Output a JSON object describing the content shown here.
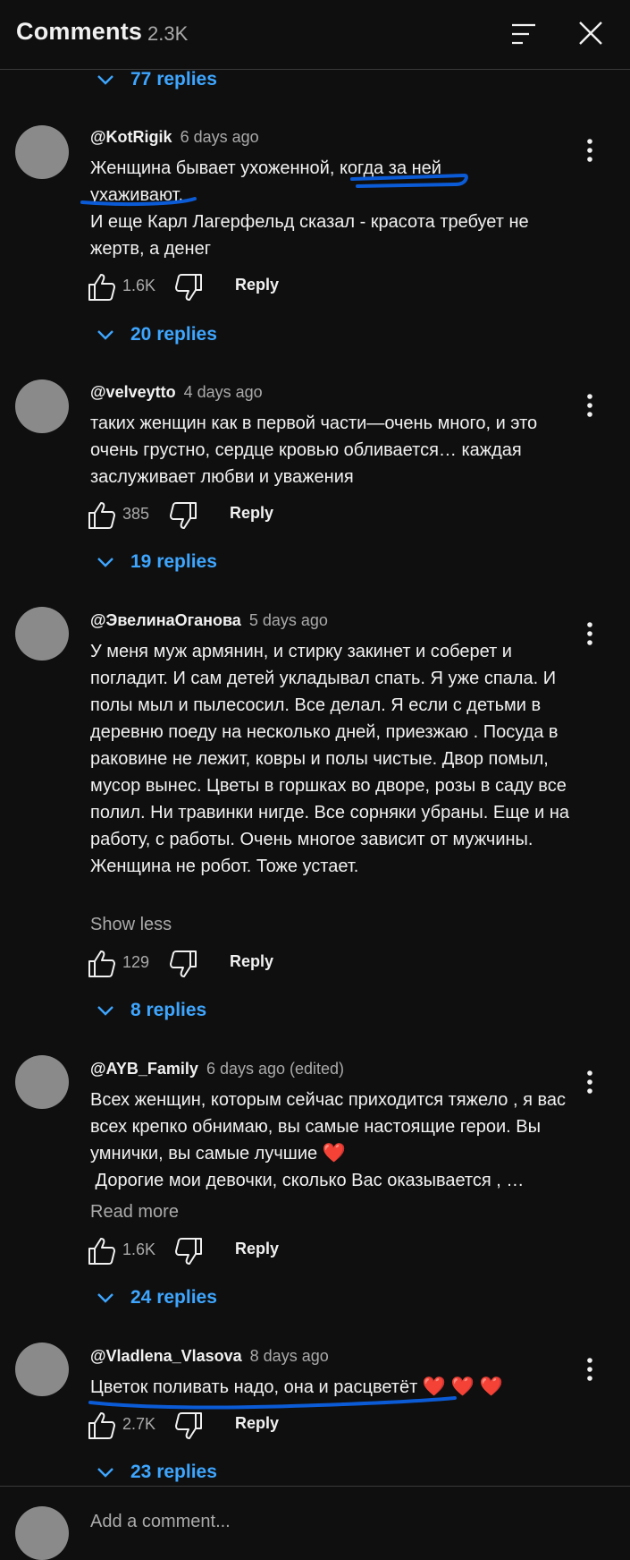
{
  "header": {
    "title": "Comments",
    "count": "2.3K"
  },
  "icons": {
    "sort": "sort-icon",
    "close": "close-icon",
    "like": "thumbs-up-icon",
    "dislike": "thumbs-down-icon",
    "more": "more-vertical-icon",
    "expand": "chevron-down-icon"
  },
  "colors": {
    "background": "#0f0f0f",
    "link": "#3ea6ff",
    "muted": "#aaaaaa",
    "avatar": "#8a8a8a",
    "heart": "#e2262c",
    "marker": "#0b5bd6"
  },
  "top_replies": "77 replies",
  "comments": [
    {
      "handle": "@KotRigik",
      "time": "6 days ago",
      "lines": [
        "Женщина бывает ухоженной, когда за ней ухаживают.",
        "И еще Карл Лагерфельд сказал - красота требует не жертв, а денег"
      ],
      "likes": "1.6K",
      "reply": "Reply",
      "replies": "20 replies"
    },
    {
      "handle": "@velveytto",
      "time": "4 days ago",
      "lines": [
        "таких женщин как в первой части—очень много, и это очень грустно, сердце кровью обливается… каждая заслуживает любви и уважения"
      ],
      "likes": "385",
      "reply": "Reply",
      "replies": "19 replies"
    },
    {
      "handle": "@ЭвелинаОганова",
      "time": "5 days ago",
      "lines": [
        "У меня муж армянин, и стирку закинет и соберет и погладит. И сам детей укладывал спать. Я уже спала. И полы мыл и пылесосил. Все делал. Я если с детьми в деревню поеду на несколько дней, приезжаю . Посуда в раковине не лежит, ковры и полы чистые. Двор помыл, мусор вынес. Цветы в горшках во дворе, розы в саду все полил. Ни травинки нигде. Все сорняки убраны. Еще и на работу, с работы. Очень многое зависит от мужчины. Женщина не робот. Тоже устает."
      ],
      "toggle": "Show less",
      "likes": "129",
      "reply": "Reply",
      "replies": "8 replies"
    },
    {
      "handle": "@AYB_Family",
      "time": "6 days ago (edited)",
      "lines": [
        "Всех женщин, которым сейчас приходится тяжело , я вас всех крепко обнимаю, вы самые настоящие герои. Вы умнички, вы самые лучшие",
        " Дорогие мои девочки, сколько Вас оказывается , …"
      ],
      "heart": "❤️",
      "toggle": "Read more",
      "likes": "1.6K",
      "reply": "Reply",
      "replies": "24 replies"
    },
    {
      "handle": "@Vladlena_Vlasova",
      "time": "8 days ago",
      "lines": [
        "Цветок поливать надо, она и расцветёт"
      ],
      "heart": "❤️ ❤️ ❤️",
      "likes": "2.7K",
      "reply": "Reply",
      "replies": "23 replies"
    }
  ],
  "composer": {
    "placeholder": "Add a comment..."
  }
}
